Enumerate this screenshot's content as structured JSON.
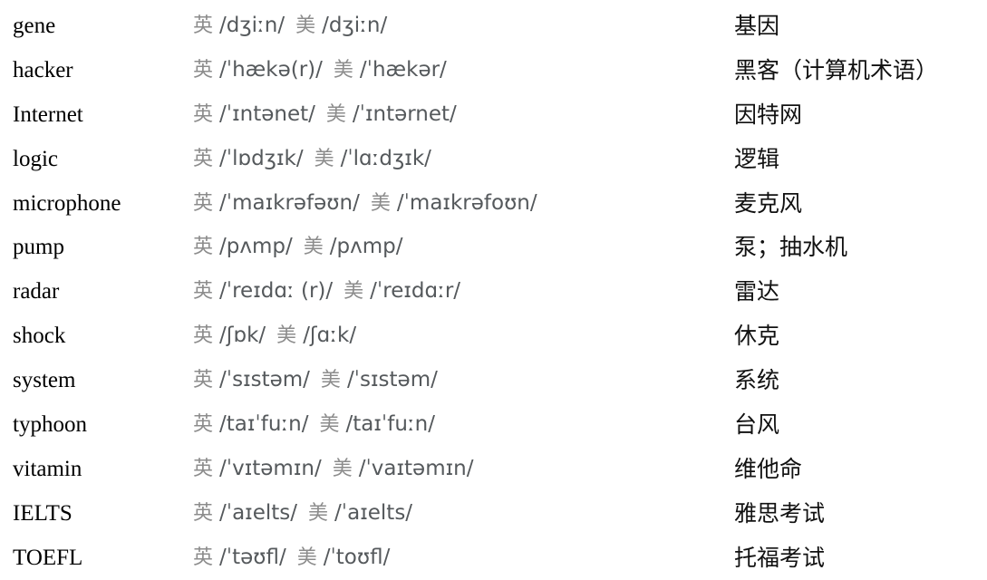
{
  "document": {
    "type": "vocabulary-list",
    "uk_label": "英",
    "us_label": "美",
    "columns": [
      "word",
      "uk_phonetic",
      "us_phonetic",
      "meaning"
    ],
    "colors": {
      "word_text": "#000000",
      "region_tag": "#8c8c8c",
      "phonetic_text": "#55595c",
      "meaning_text": "#111111",
      "background": "#ffffff"
    },
    "rows": [
      {
        "word": "gene",
        "uk": "/dʒiːn/",
        "us": "/dʒiːn/",
        "meaning": "基因"
      },
      {
        "word": "hacker",
        "uk": "/ˈhækə(r)/",
        "us": "/ˈhækər/",
        "meaning": "黑客（计算机术语）"
      },
      {
        "word": "Internet",
        "uk": "/ˈɪntənet/",
        "us": "/ˈɪntərnet/",
        "meaning": "因特网"
      },
      {
        "word": "logic",
        "uk": "/ˈlɒdʒɪk/",
        "us": "/ˈlɑːdʒɪk/",
        "meaning": "逻辑"
      },
      {
        "word": "microphone",
        "uk": "/ˈmaɪkrəfəʊn/",
        "us": "/ˈmaɪkrəfoʊn/",
        "meaning": "麦克风"
      },
      {
        "word": "pump",
        "uk": "/pʌmp/",
        "us": "/pʌmp/",
        "meaning": "泵；抽水机"
      },
      {
        "word": "radar",
        "uk": "/ˈreɪdɑː (r)/",
        "us": "/ˈreɪdɑːr/",
        "meaning": "雷达"
      },
      {
        "word": "shock",
        "uk": "/ʃɒk/",
        "us": "/ʃɑːk/",
        "meaning": "休克"
      },
      {
        "word": "system",
        "uk": "/ˈsɪstəm/",
        "us": "/ˈsɪstəm/",
        "meaning": "系统"
      },
      {
        "word": "typhoon",
        "uk": "/taɪˈfuːn/",
        "us": "/taɪˈfuːn/",
        "meaning": "台风"
      },
      {
        "word": "vitamin",
        "uk": "/ˈvɪtəmɪn/",
        "us": "/ˈvaɪtəmɪn/",
        "meaning": "维他命"
      },
      {
        "word": "IELTS",
        "uk": "/ˈaɪelts/",
        "us": "/ˈaɪelts/",
        "meaning": "雅思考试"
      },
      {
        "word": "TOEFL",
        "uk": "/ˈtəʊfl/",
        "us": "/ˈtoʊfl/",
        "meaning": "托福考试"
      }
    ]
  }
}
